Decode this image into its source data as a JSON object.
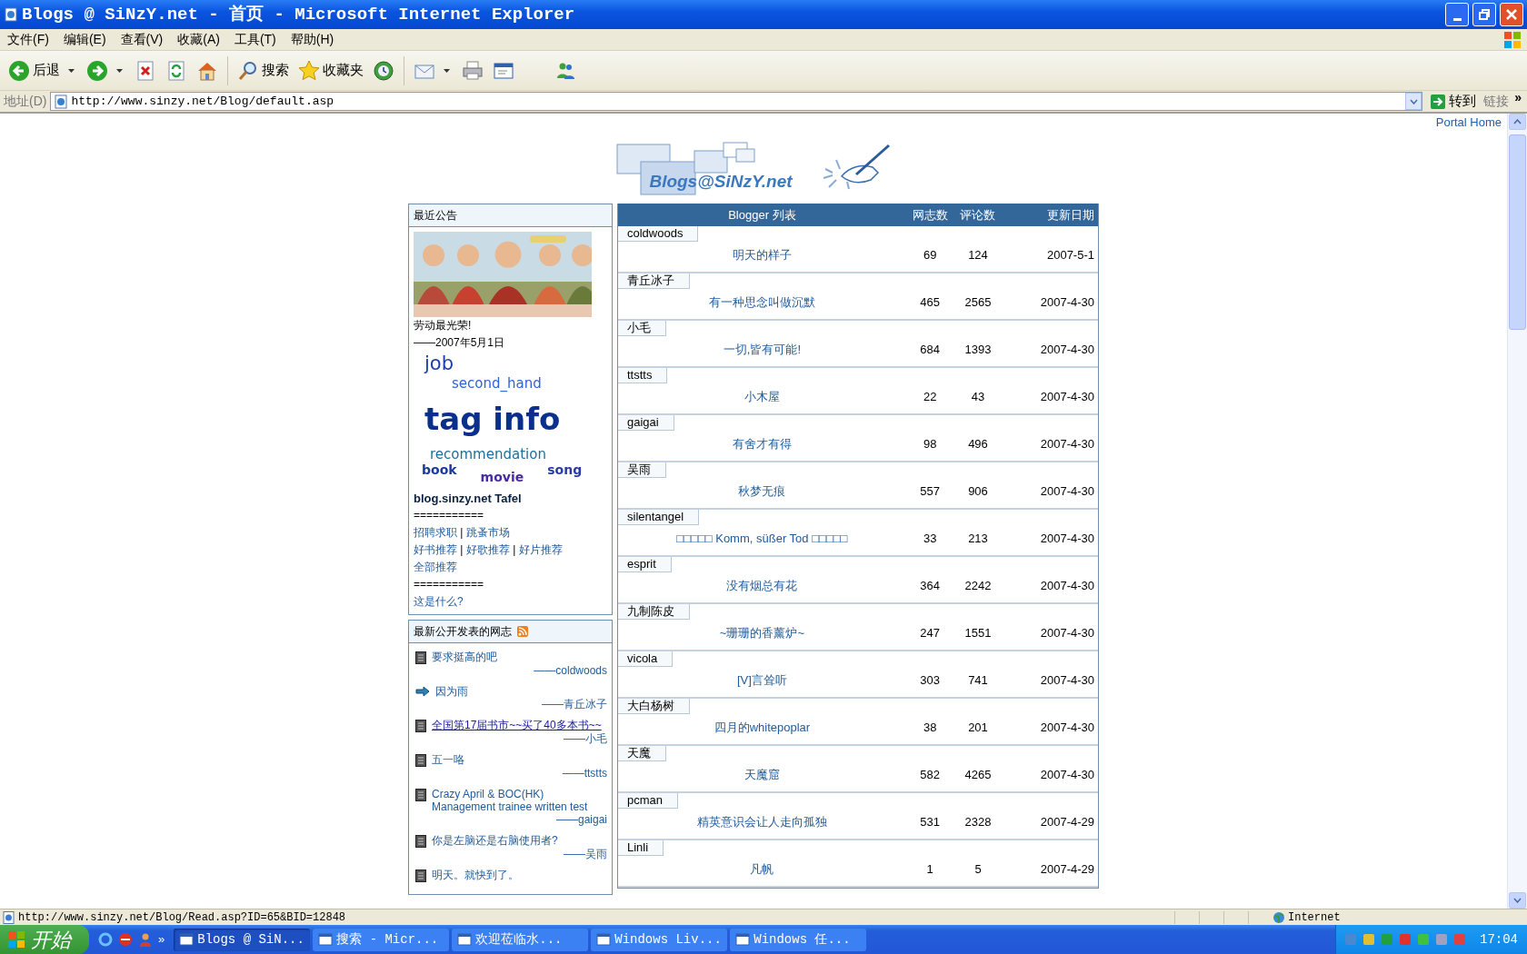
{
  "window": {
    "title": "Blogs @ SiNzY.net - 首页 - Microsoft Internet Explorer"
  },
  "menu": [
    "文件(F)",
    "编辑(E)",
    "查看(V)",
    "收藏(A)",
    "工具(T)",
    "帮助(H)"
  ],
  "toolbar": [
    {
      "kind": "back",
      "label": "后退",
      "dropdown": true
    },
    {
      "kind": "forward",
      "dropdown": true
    },
    {
      "kind": "stop"
    },
    {
      "kind": "refresh"
    },
    {
      "kind": "home"
    },
    {
      "kind": "search",
      "label": "搜索"
    },
    {
      "kind": "favorites",
      "label": "收藏夹"
    },
    {
      "kind": "history"
    },
    {
      "kind": "mail",
      "dropdown": true
    },
    {
      "kind": "print"
    },
    {
      "kind": "edit"
    },
    {
      "kind": "messenger"
    }
  ],
  "address_bar": {
    "label": "地址(D)",
    "value": "http://www.sinzy.net/Blog/default.asp",
    "go": "转到",
    "links": "链接",
    "more": "»"
  },
  "page": {
    "portal_link": "Portal Home",
    "logo": "Blogs@SiNzY.net",
    "notice": {
      "title": "最近公告",
      "picture": {
        "kind": "picture"
      },
      "caption": "劳动最光荣!",
      "date": "——2007年5月1日",
      "tag_cloud": [
        [
          {
            "text": "job",
            "kind": "medium",
            "color": "#1f3fa8"
          }
        ],
        [
          {
            "text": "second_hand",
            "kind": "small",
            "color": "#2f63d6"
          }
        ],
        [
          {
            "text": "tag info",
            "kind": "huge",
            "color": "#0b2f8c"
          }
        ],
        [
          {
            "text": "recommendation",
            "kind": "small",
            "color": "#1f6f97"
          }
        ],
        [
          {
            "text": "book",
            "kind": "tiny",
            "color": "#1b3a9a"
          },
          {
            "text": "movie",
            "kind": "tiny",
            "color": "#4a2aa0"
          },
          {
            "text": "song",
            "kind": "tiny",
            "color": "#2a3aa8"
          }
        ]
      ],
      "tafel": "blog.sinzy.net Tafel",
      "rule_top": "===========",
      "link_lines": [
        [
          {
            "kind": "link",
            "text": "招聘求职"
          },
          {
            "kind": "sep",
            "text": "|"
          },
          {
            "kind": "link",
            "text": "跳蚤市场"
          }
        ],
        [
          {
            "kind": "link",
            "text": "好书推荐"
          },
          {
            "kind": "sep",
            "text": "|"
          },
          {
            "kind": "link",
            "text": "好歌推荐"
          },
          {
            "kind": "sep",
            "text": "|"
          },
          {
            "kind": "link",
            "text": "好片推荐"
          }
        ],
        [
          {
            "kind": "link",
            "text": "全部推荐"
          }
        ]
      ],
      "rule_bottom": "===========",
      "about": "这是什么?"
    },
    "latest": {
      "title": "最新公开发表的网志",
      "posts": [
        {
          "kind": "page",
          "title": "要求挺高的吧",
          "author": "——coldwoods",
          "hovered": false
        },
        {
          "kind": "arrow",
          "title": "因为雨",
          "author": "——青丘冰子",
          "hovered": false
        },
        {
          "kind": "page",
          "title": "全国第17届书市~~买了40多本书~~",
          "author": "——小毛",
          "hovered": true
        },
        {
          "kind": "page",
          "title": "五一咯",
          "author": "——ttstts",
          "hovered": false
        },
        {
          "kind": "page",
          "title": "Crazy April & BOC(HK) Management trainee written test",
          "author": "——gaigai",
          "hovered": false
        },
        {
          "kind": "page",
          "title": "你是左脑还是右脑使用者?",
          "author": "——吴雨",
          "hovered": false
        },
        {
          "kind": "page",
          "title": "明天。就快到了。",
          "hovered": false
        }
      ]
    },
    "bloggers": {
      "columns": [
        "Blogger 列表",
        "网志数",
        "评论数",
        "更新日期"
      ],
      "rows": [
        {
          "blogger": "coldwoods",
          "title": "明天的样子",
          "posts": "69",
          "comments": "124",
          "updated": "2007-5-1"
        },
        {
          "blogger": "青丘冰子",
          "title": "有一种思念叫做沉默",
          "posts": "465",
          "comments": "2565",
          "updated": "2007-4-30"
        },
        {
          "blogger": "小毛",
          "title": "一切,皆有可能!",
          "posts": "684",
          "comments": "1393",
          "updated": "2007-4-30"
        },
        {
          "blogger": "ttstts",
          "title": "小木屋",
          "posts": "22",
          "comments": "43",
          "updated": "2007-4-30"
        },
        {
          "blogger": "gaigai",
          "title": "有舍才有得",
          "posts": "98",
          "comments": "496",
          "updated": "2007-4-30"
        },
        {
          "blogger": "吴雨",
          "title": "秋梦无痕",
          "posts": "557",
          "comments": "906",
          "updated": "2007-4-30"
        },
        {
          "blogger": "silentangel",
          "title": "□□□□□ Komm, süßer Tod □□□□□",
          "posts": "33",
          "comments": "213",
          "updated": "2007-4-30"
        },
        {
          "blogger": "esprit",
          "title": "没有烟总有花",
          "posts": "364",
          "comments": "2242",
          "updated": "2007-4-30"
        },
        {
          "blogger": "九制陈皮",
          "title": "~珊珊的香薰炉~",
          "posts": "247",
          "comments": "1551",
          "updated": "2007-4-30"
        },
        {
          "blogger": "vicola",
          "title": "[V]言耸听",
          "posts": "303",
          "comments": "741",
          "updated": "2007-4-30"
        },
        {
          "blogger": "大白杨树",
          "title": "四月的whitepoplar",
          "posts": "38",
          "comments": "201",
          "updated": "2007-4-30"
        },
        {
          "blogger": "天魔",
          "title": "天魔窟",
          "posts": "582",
          "comments": "4265",
          "updated": "2007-4-30"
        },
        {
          "blogger": "pcman",
          "title": "精英意识会让人走向孤独",
          "posts": "531",
          "comments": "2328",
          "updated": "2007-4-29"
        },
        {
          "blogger": "Linli",
          "title": "凡帆",
          "posts": "1",
          "comments": "5",
          "updated": "2007-4-29"
        }
      ]
    }
  },
  "status_bar": {
    "url": "http://www.sinzy.net/Blog/Read.asp?ID=65&BID=12848",
    "zone": "Internet"
  },
  "taskbar": {
    "start": "开始",
    "more": "»",
    "tasks": [
      {
        "label": "Blogs @ SiN...",
        "selected": true
      },
      {
        "label": "搜索 - Micr...",
        "selected": false
      },
      {
        "label": "欢迎莅临水...",
        "selected": false
      },
      {
        "label": "Windows Liv...",
        "selected": false
      },
      {
        "label": "Windows 任...",
        "selected": false
      }
    ],
    "clock": "17:04"
  }
}
